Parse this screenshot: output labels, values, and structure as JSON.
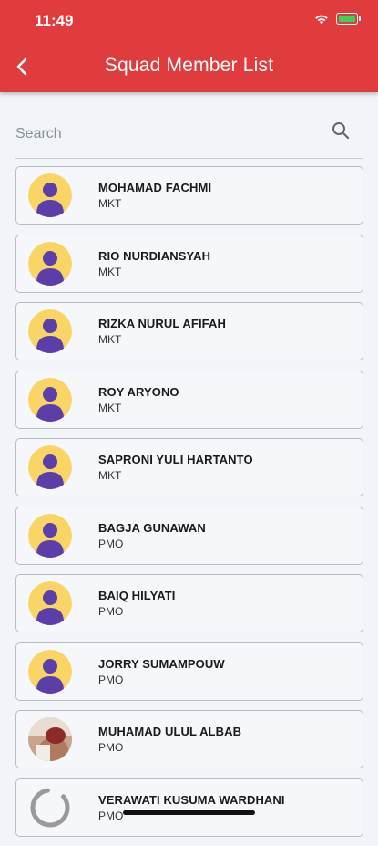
{
  "status": {
    "time": "11:49"
  },
  "header": {
    "title": "Squad Member List"
  },
  "search": {
    "placeholder": "Search",
    "value": ""
  },
  "colors": {
    "header": "#e03c3e",
    "avatar_bg": "#f8d565",
    "avatar_figure": "#5b3ea8"
  },
  "members": [
    {
      "name": "MOHAMAD FACHMI",
      "dept": "MKT",
      "avatar": "default"
    },
    {
      "name": "RIO NURDIANSYAH",
      "dept": "MKT",
      "avatar": "default"
    },
    {
      "name": "RIZKA NURUL AFIFAH",
      "dept": "MKT",
      "avatar": "default"
    },
    {
      "name": "ROY ARYONO",
      "dept": "MKT",
      "avatar": "default"
    },
    {
      "name": "SAPRONI YULI HARTANTO",
      "dept": "MKT",
      "avatar": "default"
    },
    {
      "name": "BAGJA GUNAWAN",
      "dept": "PMO",
      "avatar": "default"
    },
    {
      "name": "BAIQ HILYATI",
      "dept": "PMO",
      "avatar": "default"
    },
    {
      "name": "JORRY SUMAMPOUW",
      "dept": "PMO",
      "avatar": "default"
    },
    {
      "name": "MUHAMAD ULUL ALBAB",
      "dept": "PMO",
      "avatar": "photo"
    },
    {
      "name": "VERAWATI KUSUMA WARDHANI",
      "dept": "PMO",
      "avatar": "loading"
    }
  ]
}
